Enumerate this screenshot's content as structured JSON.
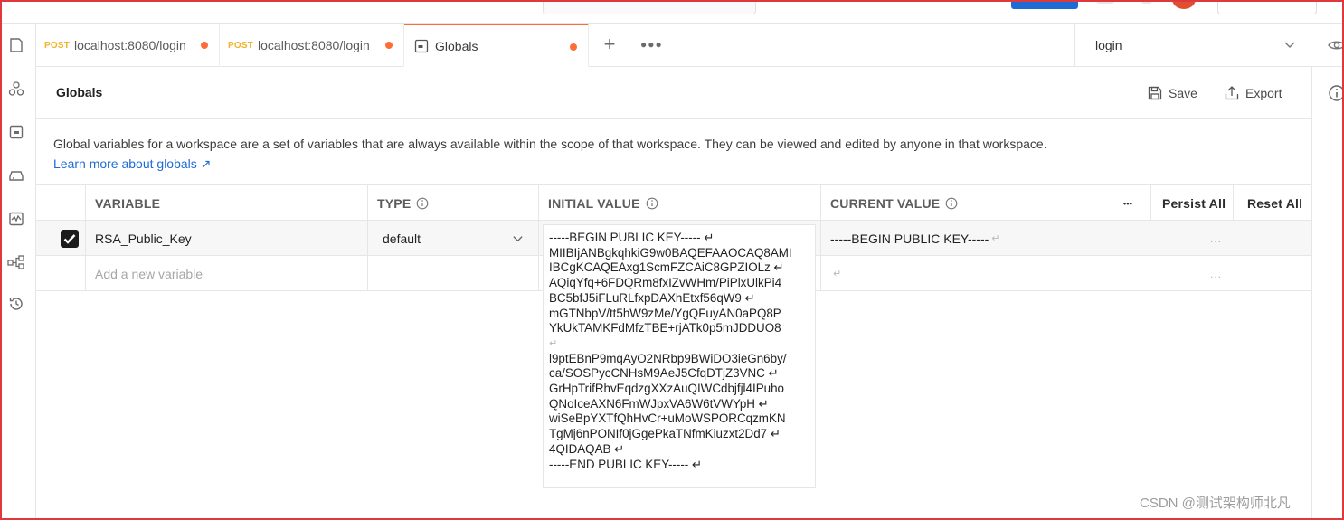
{
  "tabs": [
    {
      "method": "POST",
      "label": "localhost:8080/login",
      "unsaved": true
    },
    {
      "method": "POST",
      "label": "localhost:8080/login",
      "unsaved": true
    },
    {
      "label": "Globals",
      "unsaved": true,
      "active": true
    }
  ],
  "environment": {
    "selected": "login"
  },
  "header": {
    "title": "Globals",
    "save_label": "Save",
    "export_label": "Export"
  },
  "description": "Global variables for a workspace are a set of variables that are always available within the scope of that workspace. They can be viewed and edited by anyone in that workspace.",
  "learn_more": "Learn more about globals ↗",
  "table": {
    "columns": {
      "variable": "VARIABLE",
      "type": "TYPE",
      "initial": "INITIAL VALUE",
      "current": "CURRENT VALUE",
      "more": "•••",
      "persist": "Persist All",
      "reset": "Reset All"
    },
    "rows": [
      {
        "enabled": true,
        "variable": "RSA_Public_Key",
        "type": "default",
        "current_value": "-----BEGIN PUBLIC KEY-----",
        "return_mark": "↵",
        "row_more": "...",
        "initial_value_lines": [
          "-----BEGIN PUBLIC KEY----- ↵",
          "MIIBIjANBgkqhkiG9w0BAQEFAAOCAQ8AMI",
          "IBCgKCAQEAxg1ScmFZCAiC8GPZIOLz ↵",
          "AQiqYfq+6FDQRm8fxIZvWHm/PiPlxUlkPi4",
          "BC5bfJ5iFLuRLfxpDAXhEtxf56qW9 ↵",
          "mGTNbpV/tt5hW9zMe/YgQFuyAN0aPQ8P",
          "YkUkTAMKFdMfzTBE+rjATk0p5mJDDUO8",
          "↵",
          "l9ptEBnP9mqAyO2NRbp9BWiDO3ieGn6by/",
          "ca/SOSPycCNHsM9AeJ5CfqDTjZ3VNC ↵",
          "GrHpTrifRhvEqdzgXXzAuQIWCdbjfjl4IPuho",
          "QNoIceAXN6FmWJpxVA6W6tVWYpH ↵",
          "wiSeBpYXTfQhHvCr+uMoWSPORCqzmKN",
          "TgMj6nPONIf0jGgePkaTNfmKiuzxt2Dd7 ↵",
          "4QIDAQAB ↵",
          "-----END PUBLIC KEY----- ↵"
        ]
      }
    ],
    "new_row": {
      "placeholder": "Add a new variable",
      "return_mark": "↵",
      "row_more": "..."
    }
  },
  "watermark": "CSDN @测试架构师北凡"
}
